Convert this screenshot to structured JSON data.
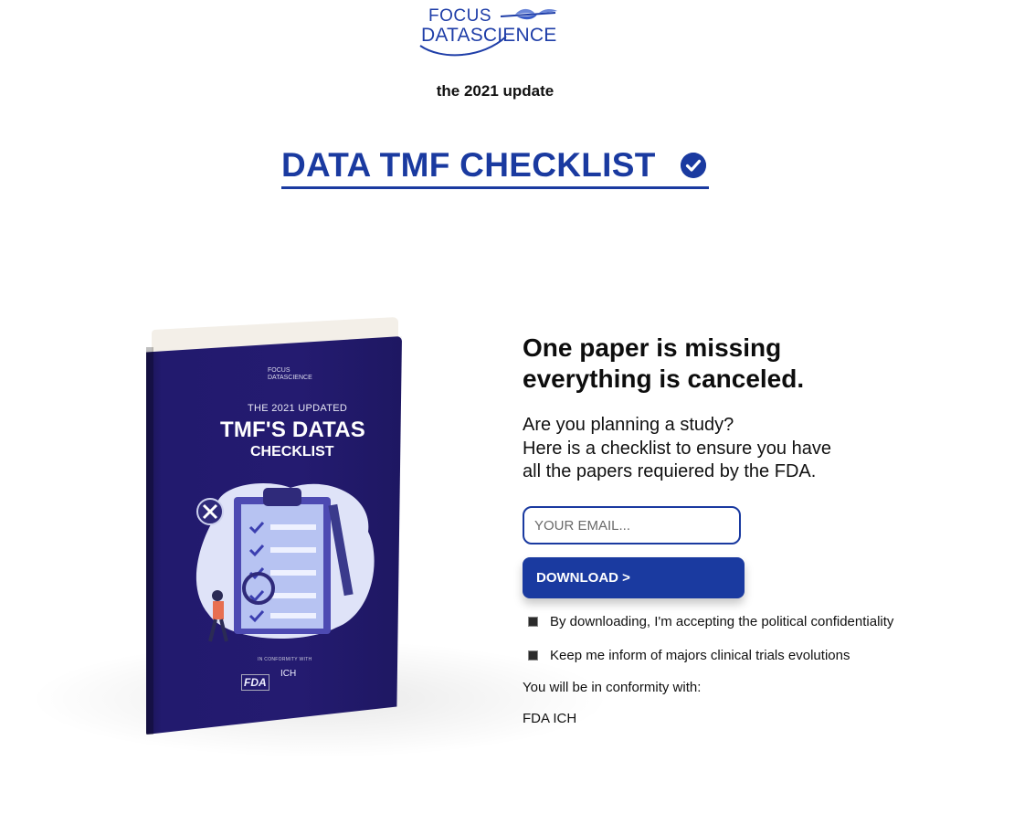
{
  "header": {
    "logo": {
      "line1": "FOCUS",
      "line2": "DATASCIENCE"
    },
    "subtitle": "the 2021 update",
    "title": "DATA TMF CHECKLIST"
  },
  "book": {
    "cover_logo_line1": "FOCUS",
    "cover_logo_line2": "DATASCIENCE",
    "kicker": "THE 2021 UPDATED",
    "title1": "TMF'S DATAS",
    "title2": "CHECKLIST",
    "conformity": "IN CONFORMITY WITH",
    "badge_fda": "FDA",
    "badge_ich": "ICH"
  },
  "signup": {
    "headline_line1": "One paper is missing",
    "headline_line2": "everything is canceled.",
    "lede_line1": "Are you planning a study?",
    "lede_line2": "Here is a checklist to ensure you have",
    "lede_line3": "all the papers requiered by the FDA.",
    "email_placeholder": "YOUR EMAIL...",
    "download_label": "DOWNLOAD >",
    "option1": "By downloading, I'm accepting the political confidentiality",
    "option2": "Keep me inform of majors clinical trials evolutions",
    "conformity_label": "You will be in conformity with:",
    "conformity_values": "FDA ICH"
  },
  "colors": {
    "brand": "#1a3aa0",
    "book": "#221a6e"
  }
}
